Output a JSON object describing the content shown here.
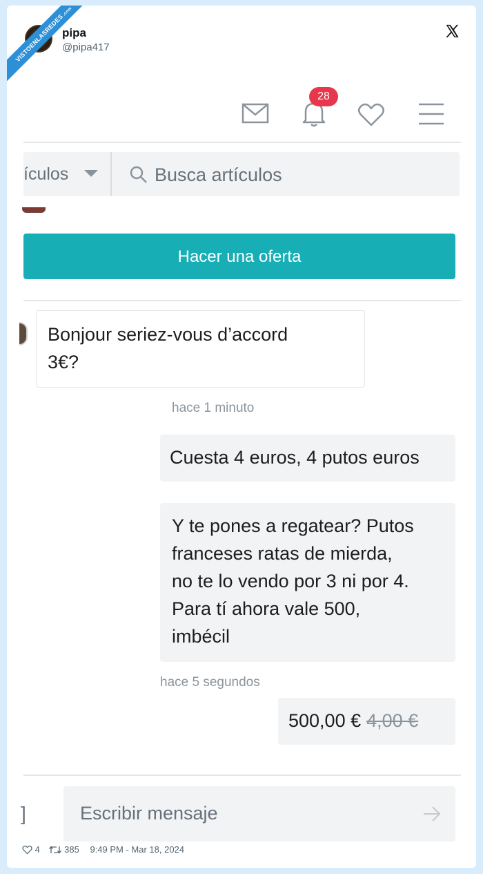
{
  "ribbon_text": "VISTOENLASREDES",
  "ribbon_sub": ".com",
  "tweet": {
    "name": "pipa",
    "handle": "@pipa417",
    "likes": "4",
    "retweets": "385",
    "timestamp": "9:49 PM - Mar 18, 2024"
  },
  "app": {
    "notification_count": "28",
    "category_label": "ículos",
    "search_placeholder": "Busca artículos",
    "offer_button": "Hacer una oferta",
    "compose_placeholder": "Escribir mensaje",
    "accent_color": "#17aeb5",
    "badge_color": "#e8364c"
  },
  "messages": [
    {
      "direction": "incoming",
      "lines": [
        "Bonjour seriez-vous d’accord",
        "3€?"
      ]
    },
    {
      "direction": "outgoing",
      "lines": [
        "Cuesta 4 euros, 4 putos euros"
      ]
    },
    {
      "direction": "outgoing",
      "lines": [
        "Y te pones a regatear? Putos",
        "franceses ratas de mierda,",
        "no te lo vendo por 3 ni por 4.",
        "Para tí ahora vale 500,",
        "imbécil"
      ]
    }
  ],
  "timestamps": {
    "first": "hace 1 minuto",
    "second": "hace 5 segundos"
  },
  "price": {
    "new": "500,00 €",
    "old": "4,00 €"
  },
  "icons": [
    "mail-icon",
    "bell-icon",
    "heart-icon",
    "menu-icon",
    "search-icon",
    "send-icon",
    "x-logo-icon",
    "like-icon",
    "retweet-icon"
  ]
}
